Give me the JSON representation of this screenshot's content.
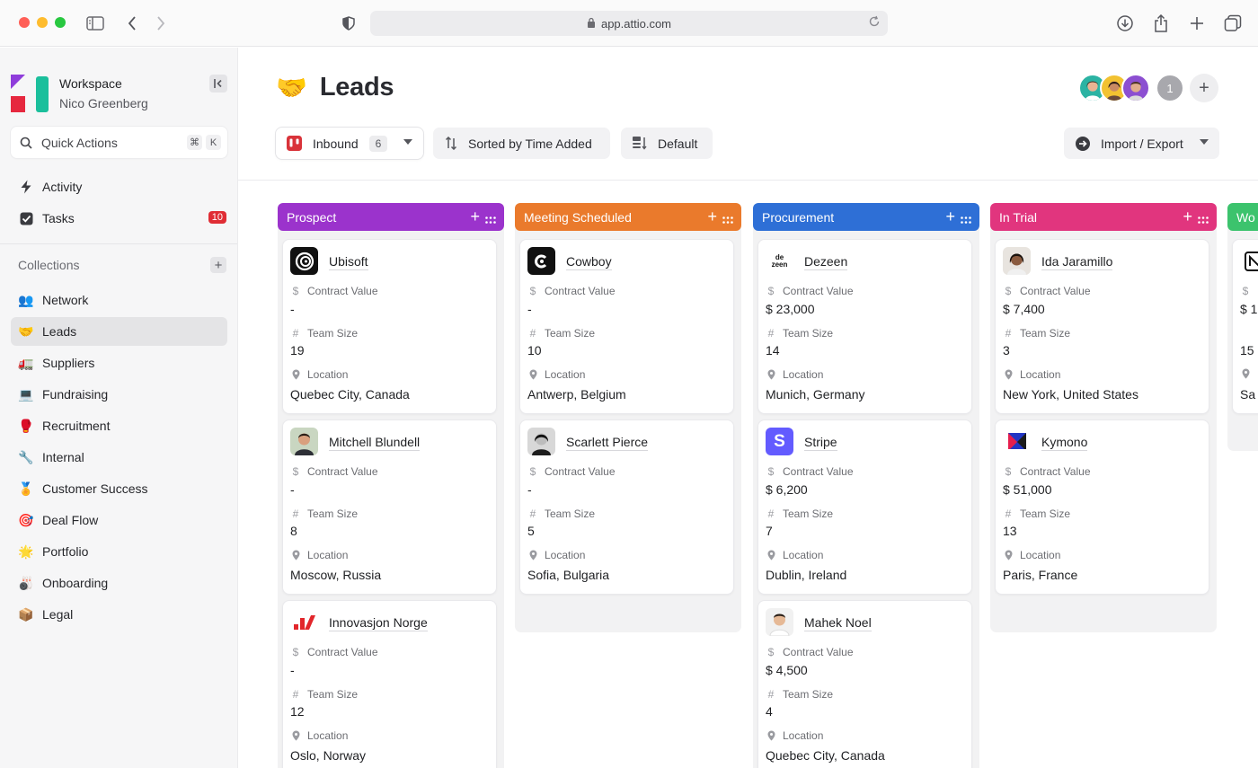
{
  "browser": {
    "url": "app.attio.com"
  },
  "sidebar": {
    "workspace_name": "Workspace",
    "user_name": "Nico Greenberg",
    "quick_actions": {
      "label": "Quick Actions",
      "key1": "⌘",
      "key2": "K"
    },
    "nav": [
      {
        "label": "Activity",
        "icon": "lightning-icon"
      },
      {
        "label": "Tasks",
        "icon": "checkbox-icon",
        "badge": "10"
      }
    ],
    "collections_label": "Collections",
    "collections": [
      {
        "label": "Network",
        "emoji": "👥"
      },
      {
        "label": "Leads",
        "emoji": "🤝",
        "active": true
      },
      {
        "label": "Suppliers",
        "emoji": "🚛"
      },
      {
        "label": "Fundraising",
        "emoji": "💻"
      },
      {
        "label": "Recruitment",
        "emoji": "🥊"
      },
      {
        "label": "Internal",
        "emoji": "🔧"
      },
      {
        "label": "Customer Success",
        "emoji": "🏅"
      },
      {
        "label": "Deal Flow",
        "emoji": "🎯"
      },
      {
        "label": "Portfolio",
        "emoji": "🌟"
      },
      {
        "label": "Onboarding",
        "emoji": "🎳"
      },
      {
        "label": "Legal",
        "emoji": "📦"
      }
    ]
  },
  "page": {
    "emoji": "🤝",
    "title": "Leads",
    "collaborator_count": "1"
  },
  "toolbar": {
    "view_label": "Inbound",
    "view_count": "6",
    "sort_label": "Sorted by Time Added",
    "default_label": "Default",
    "import_label": "Import / Export"
  },
  "field_labels": {
    "contract_value": "Contract Value",
    "team_size": "Team Size",
    "location": "Location"
  },
  "colors": {
    "prospect": "#9b33cc",
    "meeting_scheduled": "#ea7a2c",
    "procurement": "#2e6fd6",
    "in_trial": "#e1357e",
    "won": "#3cc36d"
  },
  "columns": [
    {
      "title": "Prospect",
      "cards": [
        {
          "name": "Ubisoft",
          "logo": "ubisoft-logo",
          "contract_value": "-",
          "team_size": "19",
          "location": "Quebec City, Canada"
        },
        {
          "name": "Mitchell Blundell",
          "logo": "person-avatar",
          "contract_value": "-",
          "team_size": "8",
          "location": "Moscow, Russia"
        },
        {
          "name": "Innovasjon Norge",
          "logo": "innovasjon-logo",
          "contract_value": "-",
          "team_size": "12",
          "location": "Oslo, Norway"
        }
      ]
    },
    {
      "title": "Meeting Scheduled",
      "cards": [
        {
          "name": "Cowboy",
          "logo": "cowboy-logo",
          "contract_value": "-",
          "team_size": "10",
          "location": "Antwerp, Belgium"
        },
        {
          "name": "Scarlett Pierce",
          "logo": "person-avatar",
          "contract_value": "-",
          "team_size": "5",
          "location": "Sofia, Bulgaria"
        }
      ]
    },
    {
      "title": "Procurement",
      "cards": [
        {
          "name": "Dezeen",
          "logo": "dezeen-logo",
          "logo_text": "de\nzeen",
          "contract_value": "$ 23,000",
          "team_size": "14",
          "location": "Munich, Germany"
        },
        {
          "name": "Stripe",
          "logo": "stripe-logo",
          "logo_text": "S",
          "contract_value": "$ 6,200",
          "team_size": "7",
          "location": "Dublin, Ireland"
        },
        {
          "name": "Mahek Noel",
          "logo": "person-avatar",
          "contract_value": "$ 4,500",
          "team_size": "4",
          "location": "Quebec City, Canada"
        }
      ]
    },
    {
      "title": "In Trial",
      "cards": [
        {
          "name": "Ida Jaramillo",
          "logo": "person-avatar",
          "contract_value": "$ 7,400",
          "team_size": "3",
          "location": "New York, United States"
        },
        {
          "name": "Kymono",
          "logo": "kymono-logo",
          "contract_value": "$ 51,000",
          "team_size": "13",
          "location": "Paris, France"
        }
      ]
    },
    {
      "title": "Wo",
      "cards": [
        {
          "name": "",
          "logo": "notion-logo",
          "contract_value": "$ 1",
          "team_size": "15",
          "location": "Sa"
        }
      ]
    }
  ]
}
